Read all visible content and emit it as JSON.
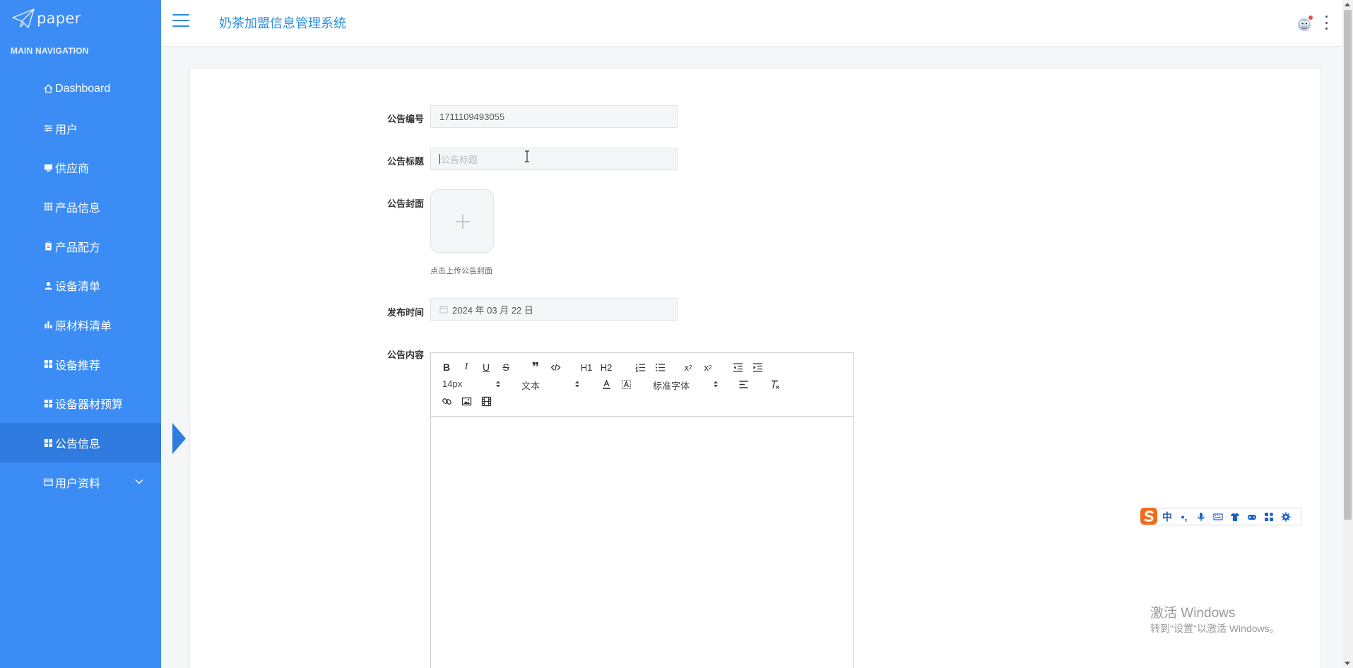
{
  "brand": {
    "name": "paper"
  },
  "sidebar": {
    "heading": "MAIN NAVIGATION",
    "items": [
      {
        "label": "Dashboard",
        "icon": "home-icon"
      },
      {
        "label": "用户",
        "icon": "sliders-icon"
      },
      {
        "label": "供应商",
        "icon": "monitor-icon"
      },
      {
        "label": "产品信息",
        "icon": "grid-icon"
      },
      {
        "label": "产品配方",
        "icon": "clipboard-icon"
      },
      {
        "label": "设备清单",
        "icon": "user-icon"
      },
      {
        "label": "原材料清单",
        "icon": "bar-chart-icon"
      },
      {
        "label": "设备推荐",
        "icon": "apps-icon"
      },
      {
        "label": "设备器材预算",
        "icon": "apps-icon"
      },
      {
        "label": "公告信息",
        "icon": "apps-icon",
        "active": true
      },
      {
        "label": "用户资料",
        "icon": "card-icon",
        "expandable": true
      }
    ]
  },
  "header": {
    "title": "奶茶加盟信息管理系统"
  },
  "form": {
    "number": {
      "label": "公告编号",
      "value": "1711109493055"
    },
    "title": {
      "label": "公告标题",
      "placeholder": "公告标题"
    },
    "cover": {
      "label": "公告封面",
      "hint": "点击上传公告封面"
    },
    "date": {
      "label": "发布时间",
      "value": "2024 年 03 月 22 日"
    },
    "content": {
      "label": "公告内容"
    }
  },
  "editor": {
    "font_size": "14px",
    "header": "文本",
    "font_family": "标准字体",
    "h1": "H1",
    "h2": "H2"
  },
  "ime": {
    "mode": "中",
    "punct": "•,"
  },
  "watermark": {
    "line1": "激活 Windows",
    "line2": "转到\"设置\"以激活 Windows。"
  },
  "colors": {
    "sidebar": "#3b8cf5",
    "active": "#2f7be0",
    "title": "#2a8ee0"
  }
}
